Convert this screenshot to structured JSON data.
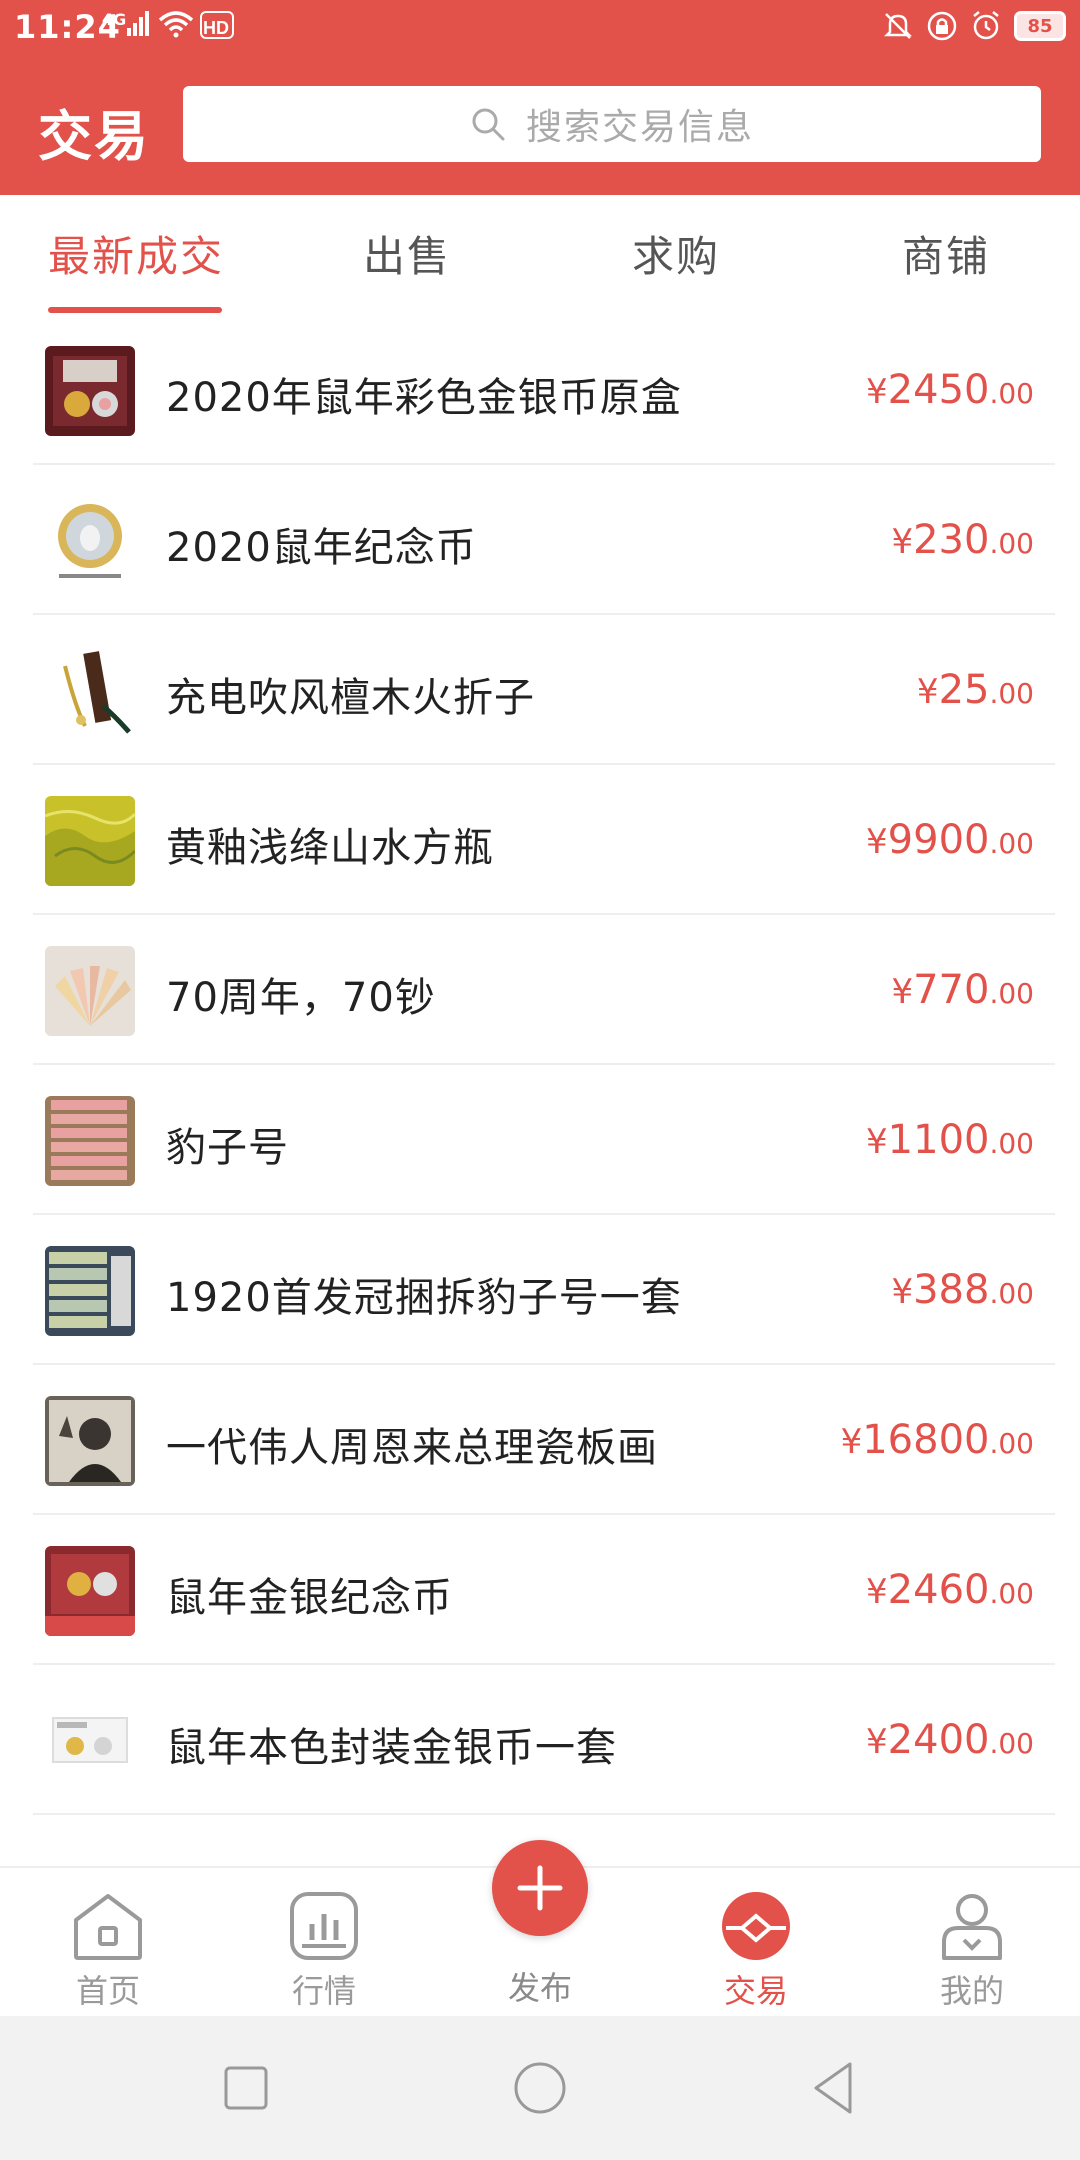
{
  "status_bar": {
    "time": "11:24",
    "network": "4G",
    "battery": "85"
  },
  "header": {
    "title": "交易",
    "search_placeholder": "搜索交易信息"
  },
  "tabs": [
    {
      "label": "最新成交",
      "active": true
    },
    {
      "label": "出售",
      "active": false
    },
    {
      "label": "求购",
      "active": false
    },
    {
      "label": "商铺",
      "active": false
    }
  ],
  "items": [
    {
      "title": "2020年鼠年彩色金银币原盒",
      "currency": "¥",
      "price_int": "2450",
      "price_dec": ".00"
    },
    {
      "title": "2020鼠年纪念币",
      "currency": "¥",
      "price_int": "230",
      "price_dec": ".00"
    },
    {
      "title": "充电吹风檀木火折子",
      "currency": "¥",
      "price_int": "25",
      "price_dec": ".00"
    },
    {
      "title": "黄釉浅绛山水方瓶",
      "currency": "¥",
      "price_int": "9900",
      "price_dec": ".00"
    },
    {
      "title": "70周年，70钞",
      "currency": "¥",
      "price_int": "770",
      "price_dec": ".00"
    },
    {
      "title": "豹子号",
      "currency": "¥",
      "price_int": "1100",
      "price_dec": ".00"
    },
    {
      "title": "1920首发冠捆拆豹子号一套",
      "currency": "¥",
      "price_int": "388",
      "price_dec": ".00"
    },
    {
      "title": "一代伟人周恩来总理瓷板画",
      "currency": "¥",
      "price_int": "16800",
      "price_dec": ".00"
    },
    {
      "title": "鼠年金银纪念币",
      "currency": "¥",
      "price_int": "2460",
      "price_dec": ".00"
    },
    {
      "title": "鼠年本色封装金银币一套",
      "currency": "¥",
      "price_int": "2400",
      "price_dec": ".00"
    }
  ],
  "bottom_nav": [
    {
      "label": "首页",
      "icon": "home-icon",
      "active": false
    },
    {
      "label": "行情",
      "icon": "chart-icon",
      "active": false
    },
    {
      "label": "发布",
      "icon": "plus-icon",
      "active": false
    },
    {
      "label": "交易",
      "icon": "trade-icon",
      "active": true
    },
    {
      "label": "我的",
      "icon": "user-icon",
      "active": false
    }
  ],
  "colors": {
    "accent": "#e2514a",
    "text_primary": "#222222",
    "text_muted": "#9a9a9a"
  }
}
